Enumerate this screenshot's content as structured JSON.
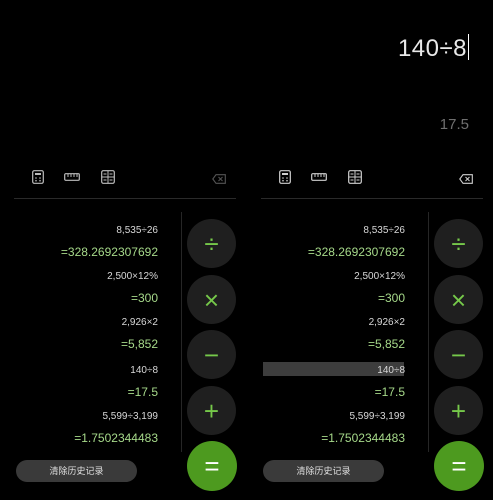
{
  "display": {
    "expression": "140÷8",
    "result_preview": "17.5"
  },
  "toolbar": {
    "icons": [
      "calculator-icon",
      "ruler-icon",
      "scientific-calculator-icon",
      "backspace-icon"
    ]
  },
  "history": [
    {
      "expr": "8,535÷26",
      "result": "=328.2692307692"
    },
    {
      "expr": "2,500×12%",
      "result": "=300"
    },
    {
      "expr": "2,926×2",
      "result": "=5,852"
    },
    {
      "expr": "140÷8",
      "result": "=17.5"
    },
    {
      "expr": "5,599÷3,199",
      "result": "=1.7502344483"
    }
  ],
  "clear_history_label": "清除历史记录",
  "operators": [
    "÷",
    "×",
    "−",
    "+",
    "="
  ],
  "colors": {
    "accent": "#76c94a",
    "equals_bg": "#4d9a1f",
    "background": "#000000"
  }
}
